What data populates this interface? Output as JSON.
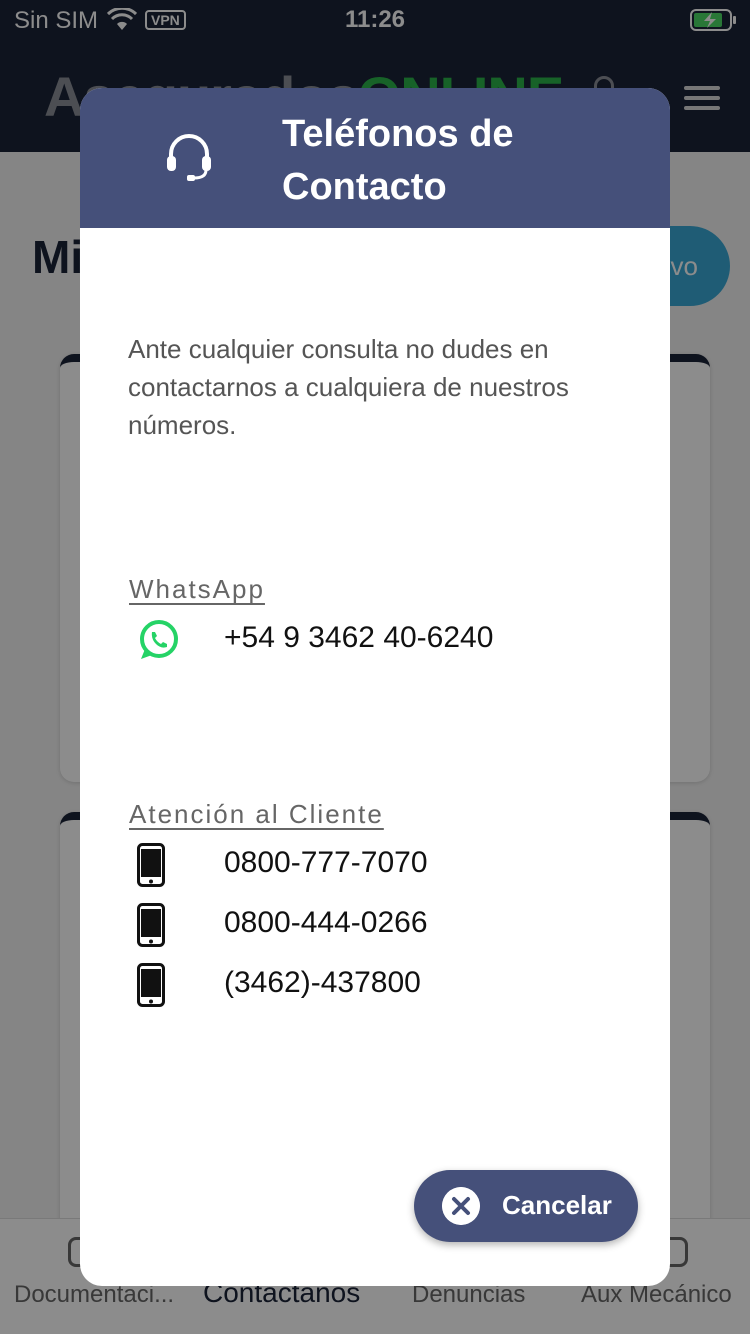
{
  "status_bar": {
    "carrier": "Sin SIM",
    "vpn": "VPN",
    "time": "11:26"
  },
  "app_header": {
    "logo_part1": "Asegurados",
    "logo_part2": "ONLINE"
  },
  "page": {
    "title_partial": "Mi",
    "new_button_partial": "evo"
  },
  "tab_bar": {
    "tabs": [
      "Documentaci...",
      "Contáctanos",
      "Denuncias",
      "Aux Mecánico"
    ],
    "active_tab": "Contáctanos"
  },
  "modal": {
    "title": "Teléfonos de Contacto",
    "header_icon": "headset-icon",
    "intro": "Ante cualquier consulta no dudes en contactarnos a cualquiera de nuestros números.",
    "whatsapp": {
      "section_title": "WhatsApp",
      "icon": "whatsapp-icon",
      "number": "+54 9 3462 40-6240",
      "color": "#25d366"
    },
    "customer_service": {
      "section_title": "Atención al Cliente",
      "icon": "mobile-phone-icon",
      "numbers": [
        "0800-777-7070",
        "0800-444-0266",
        "(3462)-437800"
      ]
    },
    "cancel_button": {
      "label": "Cancelar",
      "icon": "close-icon"
    },
    "accent_color": "#45507a"
  }
}
